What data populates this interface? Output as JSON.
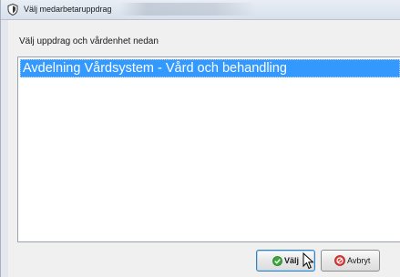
{
  "window": {
    "title": "Välj medarbetaruppdrag"
  },
  "dialog": {
    "instruction": "Välj uppdrag och vårdenhet nedan",
    "list_items": [
      {
        "label": "Avdelning Vårdsystem - Vård och behandling",
        "selected": true
      }
    ]
  },
  "buttons": {
    "ok_label": "Välj",
    "cancel_label": "Avbryt"
  },
  "icons": {
    "window": "shield-icon",
    "ok": "check-circle-icon",
    "cancel": "stop-circle-icon",
    "cursor": "mouse-pointer-icon"
  },
  "colors": {
    "selection": "#3399ff",
    "ok_icon": "#3aa83a",
    "cancel_icon": "#e03c3c"
  }
}
